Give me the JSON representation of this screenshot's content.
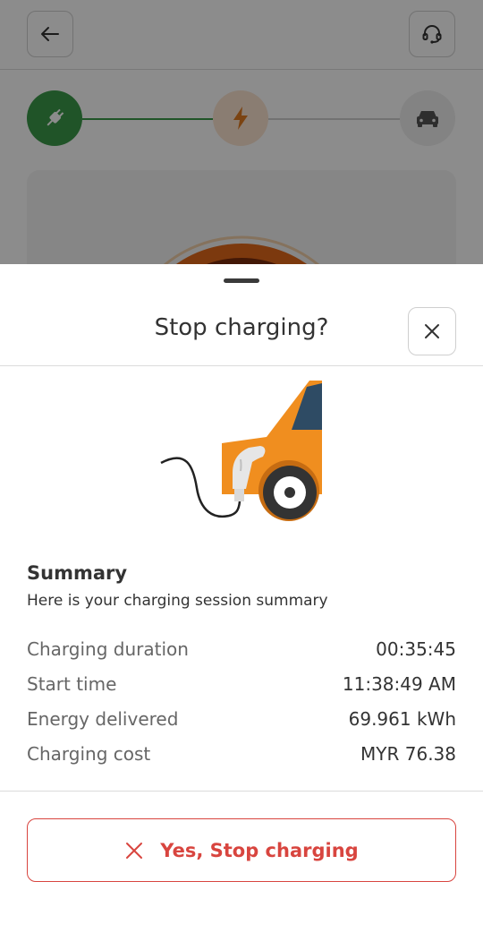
{
  "background": {
    "header": {
      "back_icon": "arrow-left-icon",
      "support_icon": "headset-icon"
    },
    "stepper": {
      "steps": [
        {
          "icon": "plug-icon",
          "state": "done",
          "color": "#3b9a4a"
        },
        {
          "icon": "lightning-icon",
          "state": "active",
          "color": "#e07a1f"
        },
        {
          "icon": "car-icon",
          "state": "pending",
          "color": "#555555"
        }
      ]
    }
  },
  "sheet": {
    "title": "Stop charging?",
    "close_icon": "close-icon",
    "illustration": "ev-charging-car-illustration",
    "summary": {
      "title": "Summary",
      "subtitle": "Here is your charging session summary",
      "rows": [
        {
          "label": "Charging duration",
          "value": "00:35:45"
        },
        {
          "label": "Start time",
          "value": "11:38:49 AM"
        },
        {
          "label": "Energy delivered",
          "value": "69.961 kWh"
        },
        {
          "label": "Charging cost",
          "value": "MYR 76.38"
        }
      ]
    },
    "stop_button": {
      "label": "Yes, Stop charging",
      "icon": "close-icon",
      "color": "#d8453f"
    }
  }
}
